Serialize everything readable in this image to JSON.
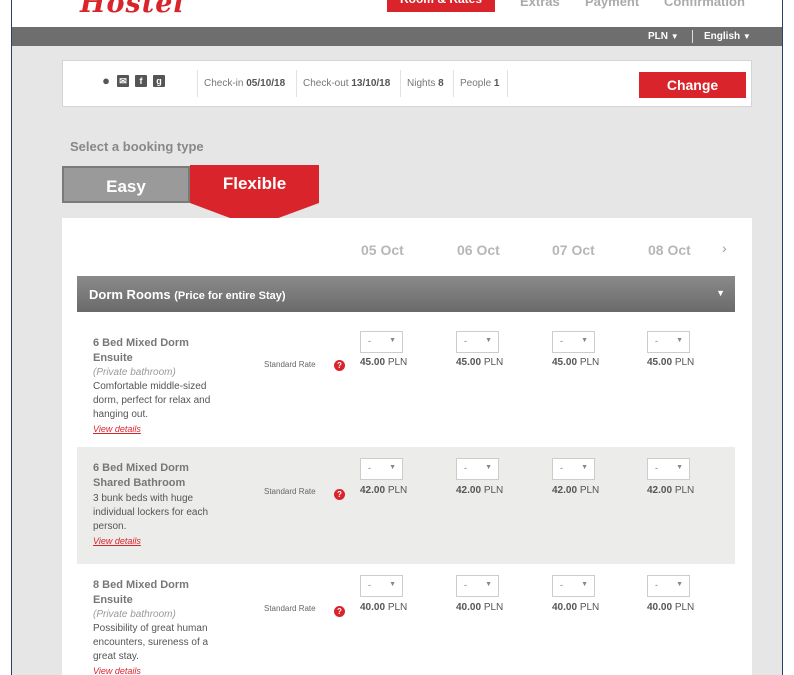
{
  "header": {
    "logo_text": "Hostel",
    "steps": [
      "Room & Rates",
      "Extras",
      "Payment",
      "Confirmation"
    ]
  },
  "topbar": {
    "currency": "PLN",
    "language": "English"
  },
  "booking_info": {
    "checkin_label": "Check-in",
    "checkin": "05/10/18",
    "checkout_label": "Check-out",
    "checkout": "13/10/18",
    "nights_label": "Nights",
    "nights": "8",
    "people_label": "People",
    "people": "1",
    "change_label": "Change"
  },
  "booking_type": {
    "label": "Select a booking type",
    "easy": "Easy",
    "flexible": "Flexible"
  },
  "dates": [
    "05 Oct",
    "06 Oct",
    "07 Oct",
    "08 Oct"
  ],
  "section": {
    "title": "Dorm Rooms",
    "subtitle": "(Price for entire Stay)"
  },
  "rooms": [
    {
      "name": "6 Bed Mixed Dorm Ensuite",
      "note": "(Private bathroom)",
      "description": "Comfortable middle-sized dorm, perfect for relax and hanging out.",
      "link": "View details",
      "rate": "Standard Rate",
      "select_value": "-",
      "prices": [
        "45.00",
        "45.00",
        "45.00",
        "45.00"
      ],
      "currency": "PLN"
    },
    {
      "name": "6 Bed Mixed Dorm Shared Bathroom",
      "note": "",
      "description": "3 bunk beds with huge individual lockers for each person.",
      "link": "View details",
      "rate": "Standard Rate",
      "select_value": "-",
      "prices": [
        "42.00",
        "42.00",
        "42.00",
        "42.00"
      ],
      "currency": "PLN"
    },
    {
      "name": "8 Bed Mixed Dorm Ensuite",
      "note": "(Private bathroom)",
      "description": "Possibility of great human encounters, sureness of a great stay.",
      "link": "View details",
      "rate": "Standard Rate",
      "select_value": "-",
      "prices": [
        "40.00",
        "40.00",
        "40.00",
        "40.00"
      ],
      "currency": "PLN"
    }
  ],
  "colors": {
    "brand_red": "#d9242b",
    "bar_gray": "#6e6e6e",
    "page_bg": "#e6e6e6"
  }
}
